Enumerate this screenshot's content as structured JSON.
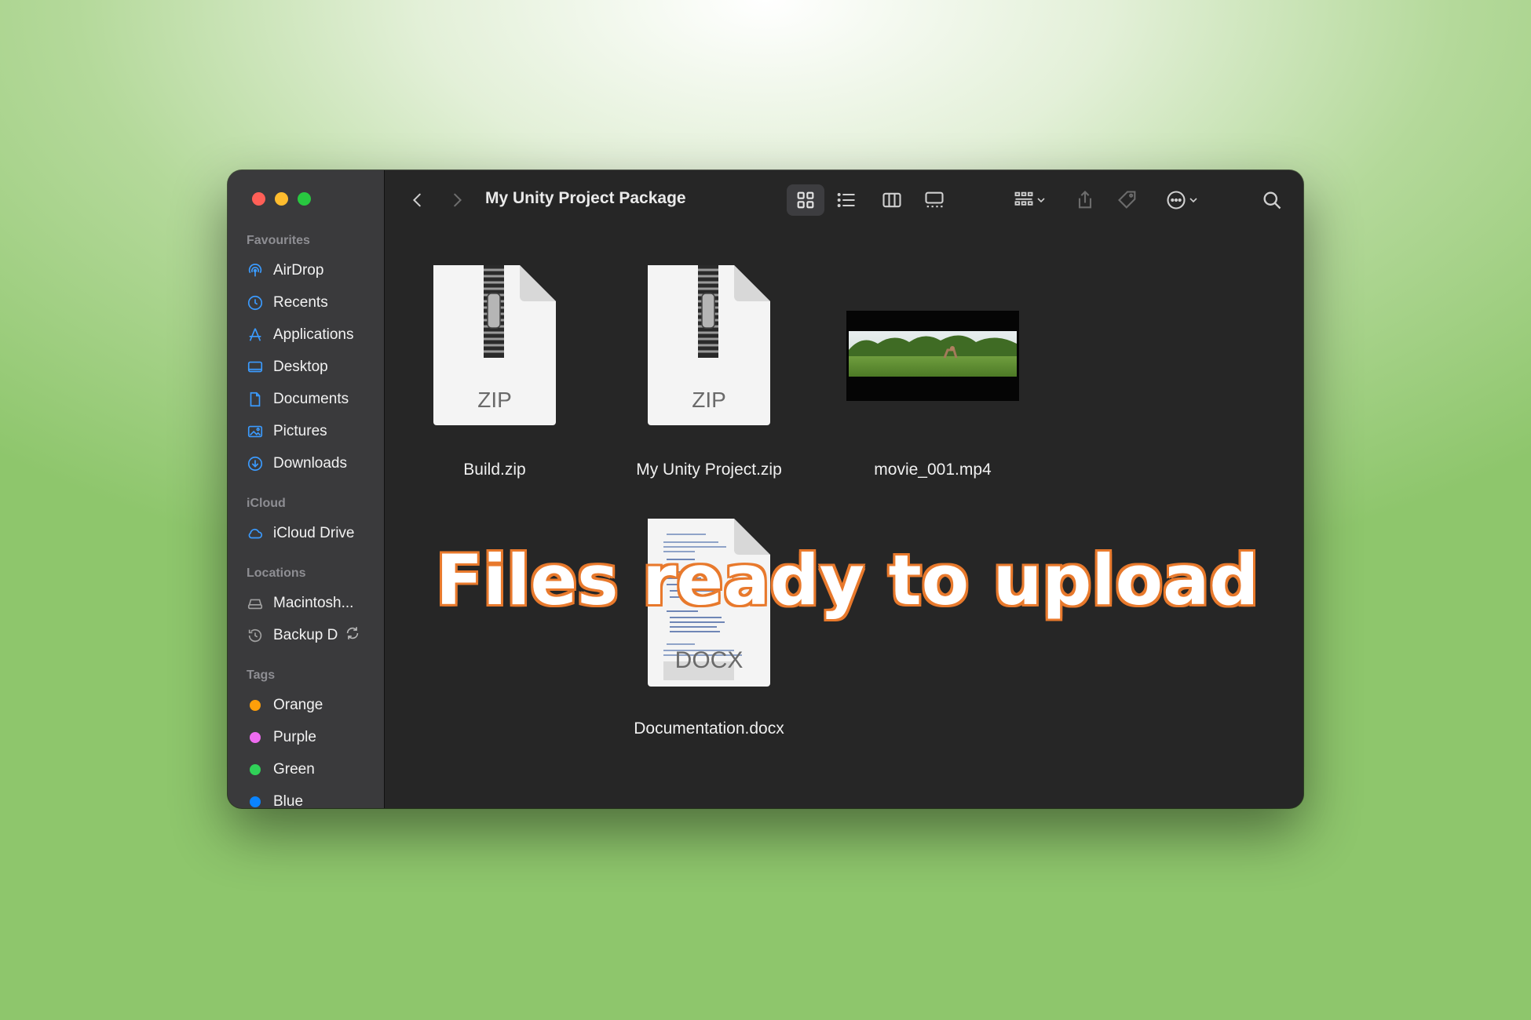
{
  "window": {
    "title": "My Unity Project Package"
  },
  "sidebar": {
    "sections": [
      {
        "heading": "Favourites",
        "items": [
          {
            "label": "AirDrop",
            "icon": "airdrop-icon"
          },
          {
            "label": "Recents",
            "icon": "clock-icon"
          },
          {
            "label": "Applications",
            "icon": "applications-icon"
          },
          {
            "label": "Desktop",
            "icon": "desktop-icon"
          },
          {
            "label": "Documents",
            "icon": "document-icon"
          },
          {
            "label": "Pictures",
            "icon": "pictures-icon"
          },
          {
            "label": "Downloads",
            "icon": "downloads-icon"
          }
        ]
      },
      {
        "heading": "iCloud",
        "items": [
          {
            "label": "iCloud Drive",
            "icon": "cloud-icon"
          }
        ]
      },
      {
        "heading": "Locations",
        "items": [
          {
            "label": "Macintosh...",
            "icon": "disk-icon"
          },
          {
            "label": "Backup D",
            "icon": "time-machine-icon"
          }
        ]
      },
      {
        "heading": "Tags",
        "items": [
          {
            "label": "Orange",
            "color": "#ff9f0a"
          },
          {
            "label": "Purple",
            "color": "#ee6cf0"
          },
          {
            "label": "Green",
            "color": "#30d158"
          },
          {
            "label": "Blue",
            "color": "#0a84ff"
          }
        ]
      }
    ],
    "accent_color": "#3b9bff"
  },
  "files": [
    {
      "name": "Build.zip",
      "type": "zip",
      "badge": "ZIP"
    },
    {
      "name": "My Unity Project.zip",
      "type": "zip",
      "badge": "ZIP"
    },
    {
      "name": "movie_001.mp4",
      "type": "video"
    },
    {
      "name": "Documentation.docx",
      "type": "docx",
      "badge": "DOCX"
    }
  ],
  "overlay_text": "Files ready to upload"
}
